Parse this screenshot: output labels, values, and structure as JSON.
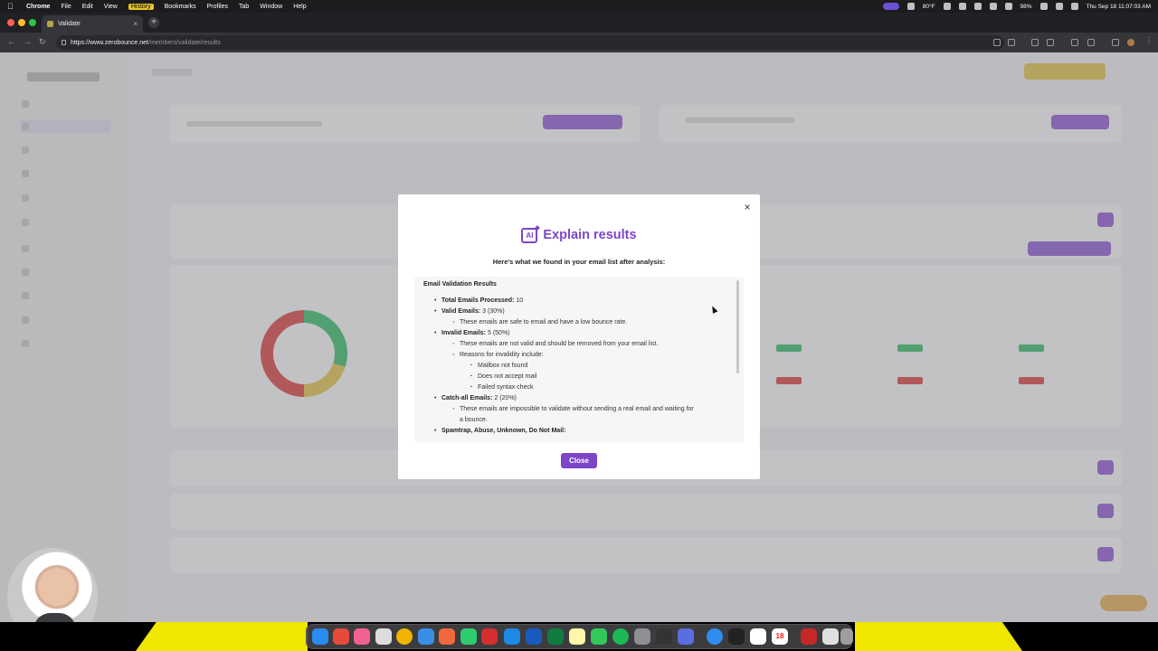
{
  "menubar": {
    "app": "Chrome",
    "items": [
      "File",
      "Edit",
      "View",
      "History",
      "Bookmarks",
      "Profiles",
      "Tab",
      "Window",
      "Help"
    ],
    "highlighted": "History",
    "status": {
      "temperature": "80°F",
      "battery": "98%",
      "datetime": "Thu Sep 18  11:07:03 AM"
    }
  },
  "browser": {
    "tab_title": "Validate",
    "url_host": "https://www.zerobounce.net",
    "url_path": "/members/validate/results"
  },
  "modal": {
    "title": "Explain results",
    "subtitle": "Here's what we found in your email list after analysis:",
    "results_heading": "Email Validation Results",
    "total": {
      "label": "Total Emails Processed:",
      "value": "10"
    },
    "valid": {
      "label": "Valid Emails:",
      "value": "3 (30%)",
      "note": "These emails are safe to email and have a low bounce rate."
    },
    "invalid": {
      "label": "Invalid Emails:",
      "value": "5 (50%)",
      "note": "These emails are not valid and should be removed from your email list.",
      "reasons_label": "Reasons for invalidity include:",
      "reasons": [
        "Mailbox not found",
        "Does not accept mail",
        "Failed syntax check"
      ]
    },
    "catchall": {
      "label": "Catch-all Emails:",
      "value": "2 (20%)",
      "note_line1": "These emails are impossible to validate without sending a real email and waiting for",
      "note_line2": "a bounce."
    },
    "other_label": "Spamtrap, Abuse, Unknown, Do Not Mail:",
    "close_label": "Close"
  },
  "colors": {
    "accent_purple": "#7d45c8",
    "valid_green": "#34c26b",
    "invalid_red": "#e0413f",
    "catchall_yellow": "#e6c84a",
    "dock_backdrop": "#f1e600"
  },
  "icons": {
    "modal_logo": "ai-sparkle-icon",
    "close": "close-icon"
  }
}
